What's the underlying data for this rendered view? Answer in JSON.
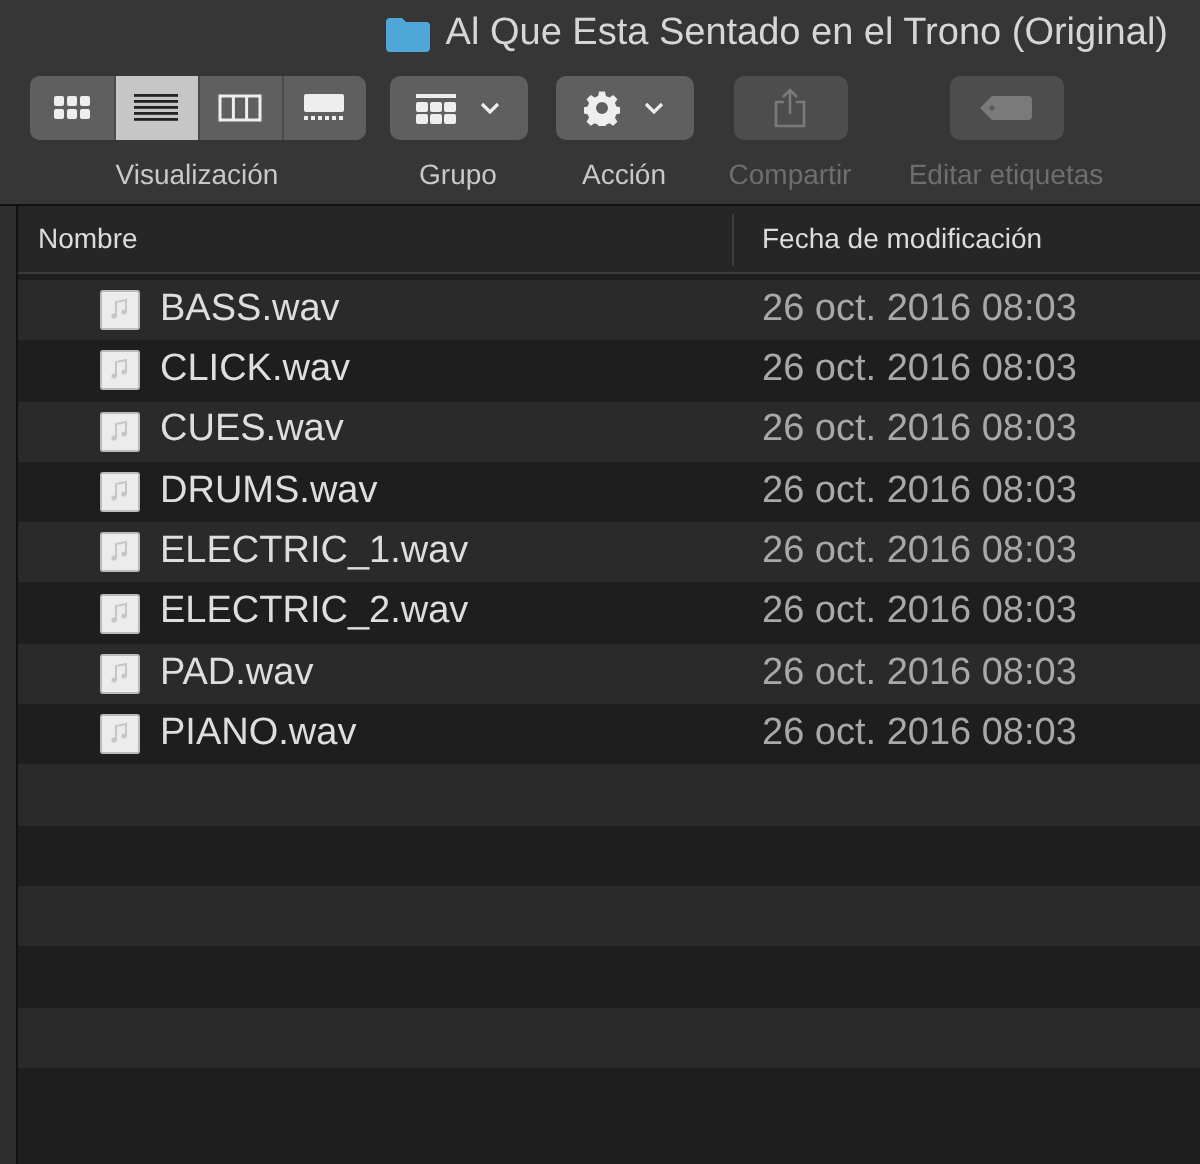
{
  "window": {
    "title": "Al Que Esta Sentado en el Trono (Original)"
  },
  "toolbar": {
    "view_modes": [
      {
        "kind": "icons",
        "selected": false
      },
      {
        "kind": "list",
        "selected": true
      },
      {
        "kind": "columns",
        "selected": false
      },
      {
        "kind": "gallery",
        "selected": false
      }
    ],
    "view_label": "Visualización",
    "items": [
      {
        "kind": "group",
        "label": "Grupo",
        "disabled": false
      },
      {
        "kind": "action",
        "label": "Acción",
        "disabled": false
      },
      {
        "kind": "share",
        "label": "Compartir",
        "disabled": true
      },
      {
        "kind": "tags",
        "label": "Editar etiquetas",
        "disabled": true
      }
    ]
  },
  "table": {
    "columns": [
      "Nombre",
      "Fecha de modificación"
    ],
    "rows": [
      {
        "name": "BASS.wav",
        "date": "26 oct. 2016 08:03"
      },
      {
        "name": "CLICK.wav",
        "date": "26 oct. 2016 08:03"
      },
      {
        "name": "CUES.wav",
        "date": "26 oct. 2016 08:03"
      },
      {
        "name": "DRUMS.wav",
        "date": "26 oct. 2016 08:03"
      },
      {
        "name": "ELECTRIC_1.wav",
        "date": "26 oct. 2016 08:03"
      },
      {
        "name": "ELECTRIC_2.wav",
        "date": "26 oct. 2016 08:03"
      },
      {
        "name": "PAD.wav",
        "date": "26 oct. 2016 08:03"
      },
      {
        "name": "PIANO.wav",
        "date": "26 oct. 2016 08:03"
      }
    ]
  }
}
